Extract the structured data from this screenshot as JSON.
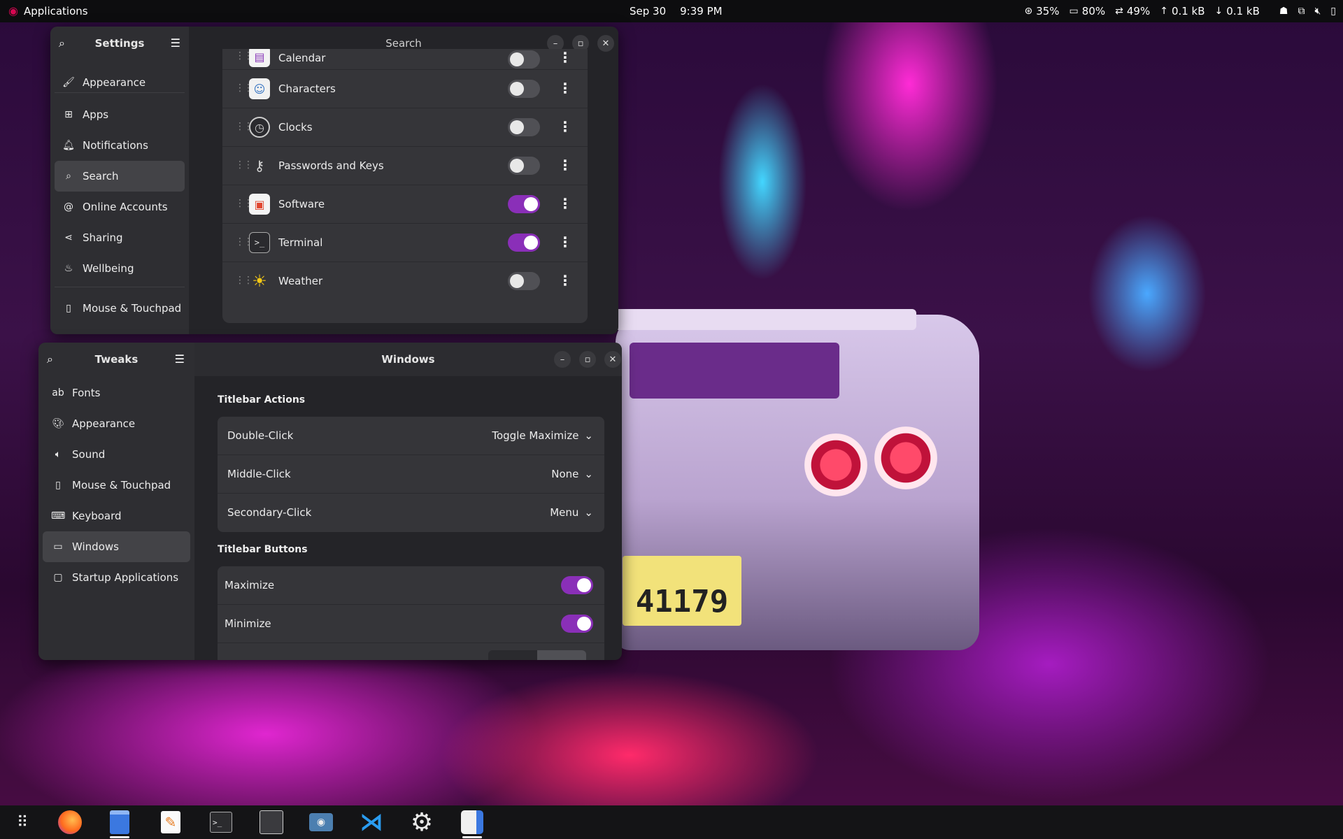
{
  "topbar": {
    "apps_label": "Applications",
    "date": "Sep 30",
    "time": "9:39 PM",
    "stats": [
      {
        "icon": "cpu-icon",
        "value": "35%"
      },
      {
        "icon": "memory-icon",
        "value": "80%"
      },
      {
        "icon": "swap-icon",
        "value": "49%"
      },
      {
        "icon": "upload-icon",
        "value": "0.1 kB"
      },
      {
        "icon": "download-icon",
        "value": "0.1 kB"
      }
    ]
  },
  "settings": {
    "title": "Settings",
    "page_title": "Search",
    "nav": [
      {
        "icon": "appearance-icon",
        "label": "Appearance"
      },
      {
        "icon": "apps-icon",
        "label": "Apps"
      },
      {
        "icon": "bell-icon",
        "label": "Notifications"
      },
      {
        "icon": "search-icon",
        "label": "Search"
      },
      {
        "icon": "at-icon",
        "label": "Online Accounts"
      },
      {
        "icon": "share-icon",
        "label": "Sharing"
      },
      {
        "icon": "wellbeing-icon",
        "label": "Wellbeing"
      },
      {
        "icon": "mouse-icon",
        "label": "Mouse & Touchpad"
      }
    ],
    "providers": [
      {
        "label": "Calendar",
        "enabled": false
      },
      {
        "label": "Characters",
        "enabled": false
      },
      {
        "label": "Clocks",
        "enabled": false
      },
      {
        "label": "Passwords and Keys",
        "enabled": false
      },
      {
        "label": "Software",
        "enabled": true
      },
      {
        "label": "Terminal",
        "enabled": true
      },
      {
        "label": "Weather",
        "enabled": false
      }
    ]
  },
  "tweaks": {
    "title": "Tweaks",
    "page_title": "Windows",
    "nav": [
      {
        "icon": "fonts-icon",
        "label": "Fonts"
      },
      {
        "icon": "appearance-icon",
        "label": "Appearance"
      },
      {
        "icon": "sound-icon",
        "label": "Sound"
      },
      {
        "icon": "mouse-icon",
        "label": "Mouse & Touchpad"
      },
      {
        "icon": "keyboard-icon",
        "label": "Keyboard"
      },
      {
        "icon": "windows-icon",
        "label": "Windows"
      },
      {
        "icon": "startup-icon",
        "label": "Startup Applications"
      }
    ],
    "titlebar_actions_heading": "Titlebar Actions",
    "actions": [
      {
        "label": "Double-Click",
        "value": "Toggle Maximize"
      },
      {
        "label": "Middle-Click",
        "value": "None"
      },
      {
        "label": "Secondary-Click",
        "value": "Menu"
      }
    ],
    "titlebar_buttons_heading": "Titlebar Buttons",
    "buttons": [
      {
        "label": "Maximize",
        "enabled": true
      },
      {
        "label": "Minimize",
        "enabled": true
      }
    ]
  },
  "plate_text": "41179",
  "dock": [
    {
      "icon": "app-grid-icon"
    },
    {
      "icon": "firefox-icon"
    },
    {
      "icon": "files-icon"
    },
    {
      "icon": "text-editor-icon"
    },
    {
      "icon": "terminal-icon"
    },
    {
      "icon": "system-monitor-icon"
    },
    {
      "icon": "screenshot-icon"
    },
    {
      "icon": "vscode-icon"
    },
    {
      "icon": "settings-gear-icon"
    },
    {
      "icon": "tweaks-icon"
    }
  ]
}
